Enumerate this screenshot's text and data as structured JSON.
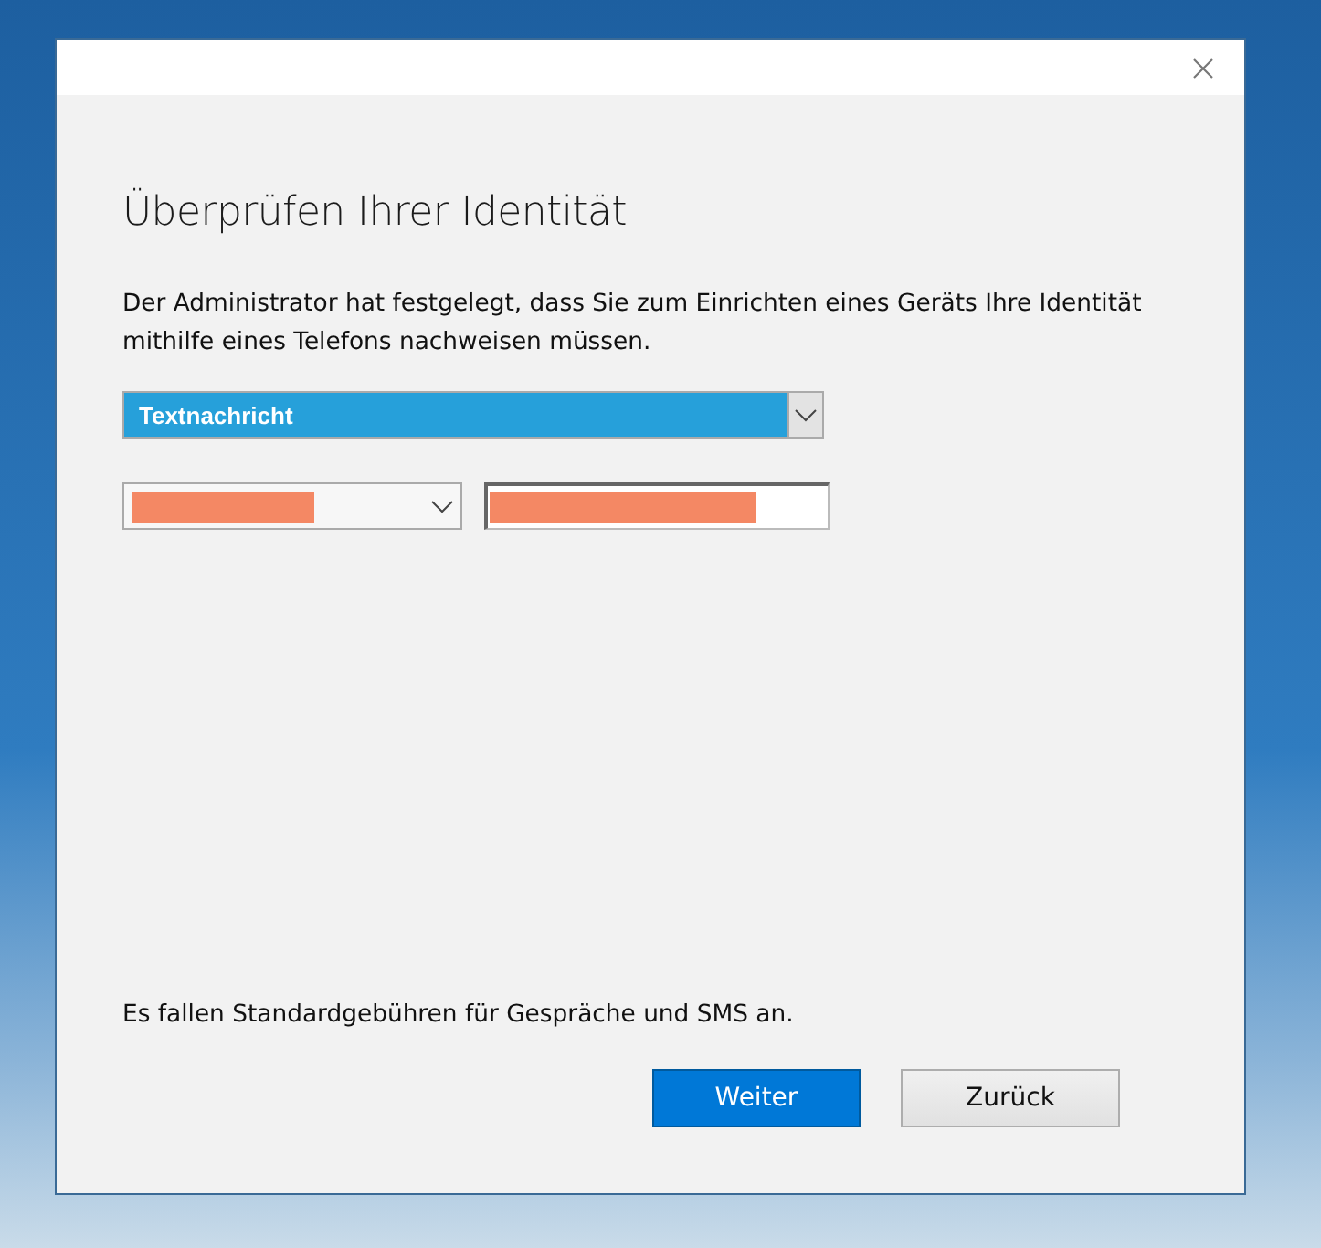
{
  "dialog": {
    "heading": "Überprüfen Ihrer Identität",
    "description": "Der Administrator hat festgelegt, dass Sie zum Einrichten eines Geräts Ihre Identität mithilfe eines Telefons nachweisen müssen.",
    "method_dropdown": {
      "value": "Textnachricht",
      "highlighted": true
    },
    "note": "Es fallen Standardgebühren für Gespräche und SMS an.",
    "buttons": [
      {
        "label": "Weiter",
        "kind": "primary"
      },
      {
        "label": "Zurück",
        "kind": "secondary"
      }
    ]
  }
}
